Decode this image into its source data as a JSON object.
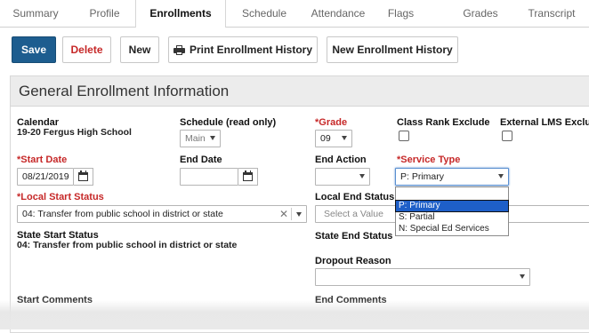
{
  "tabs": [
    "Summary",
    "Profile",
    "Enrollments",
    "Schedule",
    "Attendance",
    "Flags",
    "Grades",
    "Transcript"
  ],
  "active_tab": "Enrollments",
  "toolbar": {
    "save": "Save",
    "delete": "Delete",
    "new": "New",
    "print_history": "Print Enrollment History",
    "new_history": "New Enrollment History"
  },
  "section_title": "General Enrollment Information",
  "fields": {
    "calendar_label": "Calendar",
    "calendar_value": "19-20 Fergus High School",
    "schedule_label": "Schedule (read only)",
    "schedule_value": "Main",
    "grade_label": "*Grade",
    "grade_value": "09",
    "class_rank_label": "Class Rank Exclude",
    "external_lms_label": "External LMS Exclude",
    "start_date_label": "*Start Date",
    "start_date_value": "08/21/2019",
    "end_date_label": "End Date",
    "end_date_value": "",
    "end_action_label": "End Action",
    "end_action_value": "",
    "service_type_label": "*Service Type",
    "service_type_value": "P: Primary",
    "local_start_label": "*Local Start Status",
    "local_start_value": "04: Transfer from public school in district or state",
    "local_end_label": "Local End Status",
    "local_end_placeholder": "Select a Value",
    "state_start_label": "State Start Status",
    "state_start_value": "04: Transfer from public school in district or state",
    "state_end_label": "State End Status",
    "dropout_label": "Dropout Reason",
    "dropout_value": "",
    "start_comments_label": "Start Comments",
    "end_comments_label": "End Comments"
  },
  "service_type_options": [
    "",
    "P: Primary",
    "S: Partial",
    "N: Special Ed Services"
  ],
  "service_type_selected": "P: Primary",
  "colors": {
    "primary_button": "#1d5d8f",
    "required_label": "#c62828",
    "option_highlight": "#1e5fc8"
  }
}
